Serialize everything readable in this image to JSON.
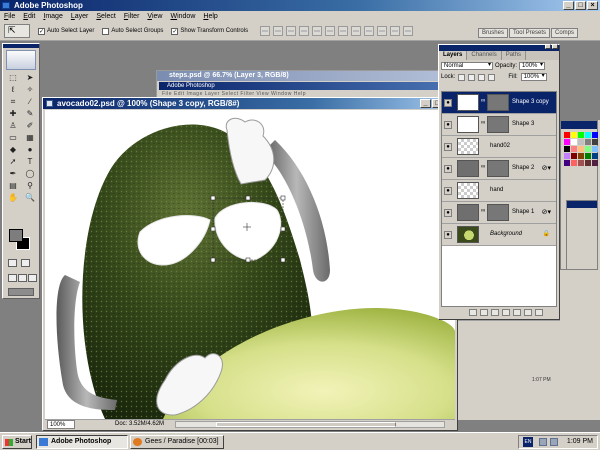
{
  "app": {
    "title": "Adobe Photoshop"
  },
  "menu": [
    "File",
    "Edit",
    "Image",
    "Layer",
    "Select",
    "Filter",
    "View",
    "Window",
    "Help"
  ],
  "options": {
    "auto_select_layer": "Auto Select Layer",
    "auto_select_groups": "Auto Select Groups",
    "show_transform_controls": "Show Transform Controls"
  },
  "palette_well": [
    "Brushes",
    "Tool Presets",
    "Comps"
  ],
  "documents": {
    "main": {
      "title": "avocado02.psd @ 100% (Shape 3 copy, RGB/8#)",
      "zoom": "100%",
      "doc_info": "Doc: 3.52M/4.62M"
    },
    "background": {
      "title": "steps.psd @ 66.7% (Layer 3, RGB/8)",
      "inner_title": "Adobe Photoshop"
    }
  },
  "layers_panel": {
    "tabs": [
      "Layers",
      "Channels",
      "Paths"
    ],
    "blend_mode": "Normal",
    "opacity_label": "Opacity:",
    "opacity": "100%",
    "lock_label": "Lock:",
    "fill_label": "Fill:",
    "fill": "100%",
    "layers": [
      {
        "name": "Shape 3 copy",
        "selected": true,
        "thumb": "white",
        "mask": true,
        "fx": false,
        "lock": false
      },
      {
        "name": "Shape 3",
        "selected": false,
        "thumb": "white",
        "mask": true,
        "fx": false,
        "lock": false
      },
      {
        "name": "hand02",
        "selected": false,
        "thumb": "checker",
        "mask": false,
        "fx": false,
        "lock": false
      },
      {
        "name": "Shape 2",
        "selected": false,
        "thumb": "gray",
        "mask": true,
        "fx": true,
        "lock": false
      },
      {
        "name": "hand",
        "selected": false,
        "thumb": "checker",
        "mask": false,
        "fx": false,
        "lock": false
      },
      {
        "name": "Shape 1",
        "selected": false,
        "thumb": "gray",
        "mask": true,
        "fx": true,
        "lock": false
      },
      {
        "name": "Background",
        "selected": false,
        "thumb": "avocado",
        "mask": false,
        "fx": false,
        "lock": true
      }
    ]
  },
  "history_strip": {
    "clock": "1:07 PM"
  },
  "taskbar": {
    "start": "Start",
    "tasks": [
      "Adobe Photoshop",
      "Gees / Paradise [00:03]"
    ],
    "tray_lang": "EN",
    "clock": "1:09 PM"
  },
  "colors": {
    "titlebar": "#0a246a",
    "face": "#d4d0c8",
    "avocado_skin": "#2f3f16",
    "avocado_flesh": "#c6d970",
    "foreground_swatch": "#7d7d7d",
    "background_swatch": "#000000"
  },
  "icons": [
    "app-icon",
    "move-tool-icon",
    "eye-icon",
    "chain-link-icon",
    "fx-icon",
    "lock-icon",
    "start-flag-icon"
  ]
}
